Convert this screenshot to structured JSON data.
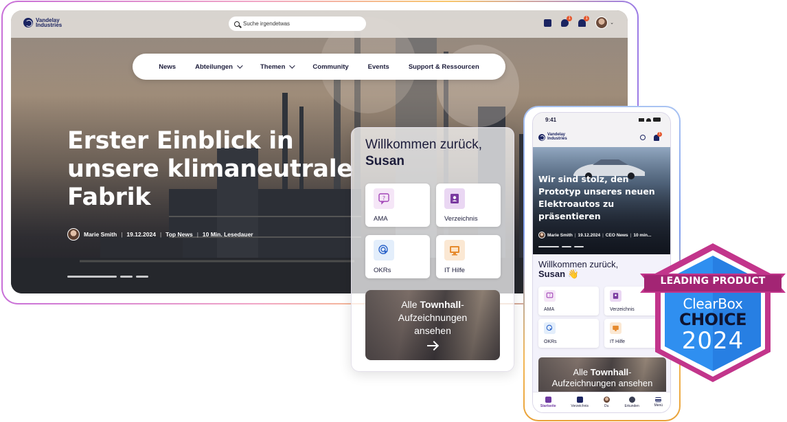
{
  "brand": {
    "name": "Vandelay Industries"
  },
  "desktop": {
    "search": {
      "placeholder": "Suche irgendetwas"
    },
    "header_badges": {
      "chat": "1",
      "bell": "1"
    },
    "nav": [
      {
        "label": "News",
        "dropdown": false
      },
      {
        "label": "Abteilungen",
        "dropdown": true
      },
      {
        "label": "Themen",
        "dropdown": true
      },
      {
        "label": "Community",
        "dropdown": false
      },
      {
        "label": "Events",
        "dropdown": false
      },
      {
        "label": "Support & Ressourcen",
        "dropdown": false
      }
    ],
    "hero": {
      "title": "Erster Einblick in unsere klimaneutrale Fabrik",
      "author": "Marie Smith",
      "date": "19.12.2024",
      "category": "Top News",
      "read_time": "10 Min. Lesedauer"
    }
  },
  "welcome_card": {
    "greeting": "Willkommen zurück,",
    "name": "Susan",
    "tiles": [
      {
        "label": "AMA",
        "icon": "question-bubble-icon"
      },
      {
        "label": "Verzeichnis",
        "icon": "contacts-book-icon"
      },
      {
        "label": "OKRs",
        "icon": "target-cursor-icon"
      },
      {
        "label": "IT Hilfe",
        "icon": "monitor-icon"
      }
    ],
    "townhall": {
      "line1": "Alle",
      "bold": "Townhall",
      "line1_suffix": "-",
      "line2": "Aufzeichnungen",
      "line3": "ansehen"
    }
  },
  "mobile": {
    "time": "9:41",
    "bell_badge": "1",
    "hero": {
      "title": "Wir sind stolz, den Prototyp unseres neuen Elektroautos zu präsentieren",
      "author": "Marie Smith",
      "date": "19.12.2024",
      "category": "CEO News",
      "read_time": "10 min..."
    },
    "greeting": "Willkommen zurück,",
    "name": "Susan",
    "wave": "👋",
    "tiles": [
      {
        "label": "AMA"
      },
      {
        "label": "Verzeichnis"
      },
      {
        "label": "OKRs"
      },
      {
        "label": "IT Hilfe"
      }
    ],
    "townhall": {
      "line1": "Alle",
      "bold": "Townhall",
      "line1_suffix": "-",
      "line2": "Aufzeichnungen ansehen"
    },
    "tabs": [
      {
        "label": "Startseite",
        "active": true
      },
      {
        "label": "Verzeichnis",
        "active": false
      },
      {
        "label": "Du",
        "active": false
      },
      {
        "label": "Erkunden",
        "active": false
      },
      {
        "label": "Menü",
        "active": false
      }
    ]
  },
  "award": {
    "ribbon": "LEADING PRODUCT",
    "brand": "ClearBox",
    "choice": "CHOICE",
    "year": "2024",
    "colors": {
      "ribbon": "#c2358b",
      "shield": "#2f8ff0",
      "shield_dark": "#1f6fd6"
    }
  },
  "colors": {
    "navy": "#1b2461",
    "accent_purple": "#6f3aa1",
    "badge_orange": "#e4572e"
  }
}
